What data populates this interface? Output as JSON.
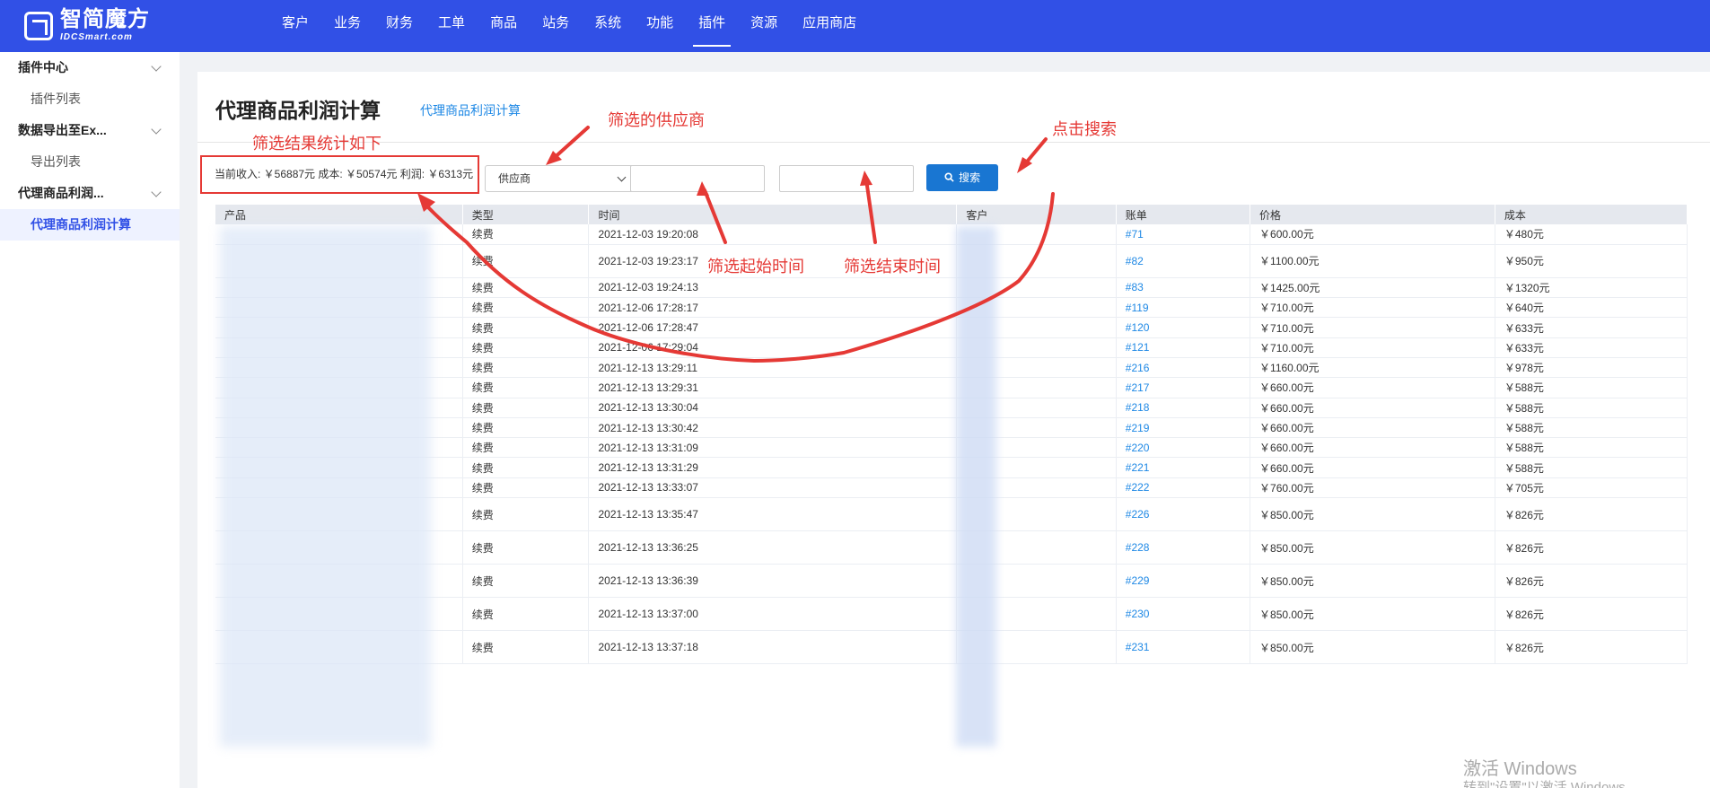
{
  "brand": {
    "name": "智简魔方",
    "sub": "IDCSmart.com"
  },
  "nav": [
    "客户",
    "业务",
    "财务",
    "工单",
    "商品",
    "站务",
    "系统",
    "功能",
    "插件",
    "资源",
    "应用商店"
  ],
  "nav_active": "插件",
  "sidebar": {
    "groups": [
      {
        "label": "插件中心",
        "items": [
          "插件列表"
        ]
      },
      {
        "label": "数据导出至Ex...",
        "items": [
          "导出列表"
        ]
      },
      {
        "label": "代理商品利润...",
        "items": [
          "代理商品利润计算"
        ]
      }
    ],
    "active_item": "代理商品利润计算"
  },
  "page": {
    "title": "代理商品利润计算",
    "link": "代理商品利润计算"
  },
  "stats": {
    "text": "当前收入: ￥56887元 成本: ￥50574元 利润: ￥6313元"
  },
  "filter": {
    "supplier_placeholder": "供应商",
    "search_label": "搜索"
  },
  "annotations": {
    "stats_label": "筛选结果统计如下",
    "supplier": "筛选的供应商",
    "search": "点击搜索",
    "start_time": "筛选起始时间",
    "end_time": "筛选结束时间"
  },
  "table": {
    "columns": [
      "产品",
      "类型",
      "时间",
      "客户",
      "账单",
      "价格",
      "成本"
    ],
    "rows": [
      [
        "",
        "续费",
        "2021-12-03 19:20:08",
        "",
        "#71",
        "￥600.00元",
        "￥480元"
      ],
      [
        "",
        "续费",
        "2021-12-03 19:23:17",
        "",
        "#82",
        "￥1100.00元",
        "￥950元"
      ],
      [
        "",
        "续费",
        "2021-12-03 19:24:13",
        "",
        "#83",
        "￥1425.00元",
        "￥1320元"
      ],
      [
        "",
        "续费",
        "2021-12-06 17:28:17",
        "",
        "#119",
        "￥710.00元",
        "￥640元"
      ],
      [
        "",
        "续费",
        "2021-12-06 17:28:47",
        "",
        "#120",
        "￥710.00元",
        "￥633元"
      ],
      [
        "",
        "续费",
        "2021-12-06 17:29:04",
        "",
        "#121",
        "￥710.00元",
        "￥633元"
      ],
      [
        "",
        "续费",
        "2021-12-13 13:29:11",
        "",
        "#216",
        "￥1160.00元",
        "￥978元"
      ],
      [
        "",
        "续费",
        "2021-12-13 13:29:31",
        "",
        "#217",
        "￥660.00元",
        "￥588元"
      ],
      [
        "",
        "续费",
        "2021-12-13 13:30:04",
        "",
        "#218",
        "￥660.00元",
        "￥588元"
      ],
      [
        "",
        "续费",
        "2021-12-13 13:30:42",
        "",
        "#219",
        "￥660.00元",
        "￥588元"
      ],
      [
        "",
        "续费",
        "2021-12-13 13:31:09",
        "",
        "#220",
        "￥660.00元",
        "￥588元"
      ],
      [
        "",
        "续费",
        "2021-12-13 13:31:29",
        "",
        "#221",
        "￥660.00元",
        "￥588元"
      ],
      [
        "",
        "续费",
        "2021-12-13 13:33:07",
        "",
        "#222",
        "￥760.00元",
        "￥705元"
      ],
      [
        "",
        "续费",
        "2021-12-13 13:35:47",
        "",
        "#226",
        "￥850.00元",
        "￥826元"
      ],
      [
        "",
        "续费",
        "2021-12-13 13:36:25",
        "",
        "#228",
        "￥850.00元",
        "￥826元"
      ],
      [
        "",
        "续费",
        "2021-12-13 13:36:39",
        "",
        "#229",
        "￥850.00元",
        "￥826元"
      ],
      [
        "",
        "续费",
        "2021-12-13 13:37:00",
        "",
        "#230",
        "￥850.00元",
        "￥826元"
      ],
      [
        "",
        "续费",
        "2021-12-13 13:37:18",
        "",
        "#231",
        "￥850.00元",
        "￥826元"
      ]
    ],
    "tall_rows": [
      1,
      13,
      14,
      15,
      16,
      17
    ]
  },
  "watermark": {
    "title": "激活 Windows",
    "sub": "转到\"设置\"以激活 Windows"
  },
  "colors": {
    "nav_bg": "#3150e6",
    "accent": "#1976d2",
    "annotation": "#e53935"
  }
}
